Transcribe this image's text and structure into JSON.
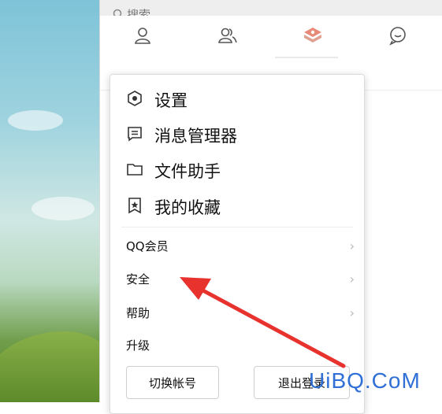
{
  "search": {
    "label": "搜索"
  },
  "tabs": [
    {
      "icon": "contact-icon"
    },
    {
      "icon": "group-icon"
    },
    {
      "icon": "space-icon"
    },
    {
      "icon": "chat-icon"
    }
  ],
  "menu": {
    "primary": [
      {
        "label": "设置",
        "icon": "settings-hexagon-icon"
      },
      {
        "label": "消息管理器",
        "icon": "message-box-icon"
      },
      {
        "label": "文件助手",
        "icon": "folder-icon"
      },
      {
        "label": "我的收藏",
        "icon": "bookmark-star-icon"
      }
    ],
    "secondary": [
      {
        "label": "QQ会员",
        "has_submenu": true
      },
      {
        "label": "安全",
        "has_submenu": true
      },
      {
        "label": "帮助",
        "has_submenu": true
      },
      {
        "label": "升级",
        "has_submenu": false
      }
    ],
    "chevron": "›",
    "switch_account": "切换帐号",
    "logout": "退出登录"
  },
  "watermark": "UiBQ.CoM",
  "colors": {
    "arrow": "#e8322e",
    "accent": "#2f6fd6"
  }
}
